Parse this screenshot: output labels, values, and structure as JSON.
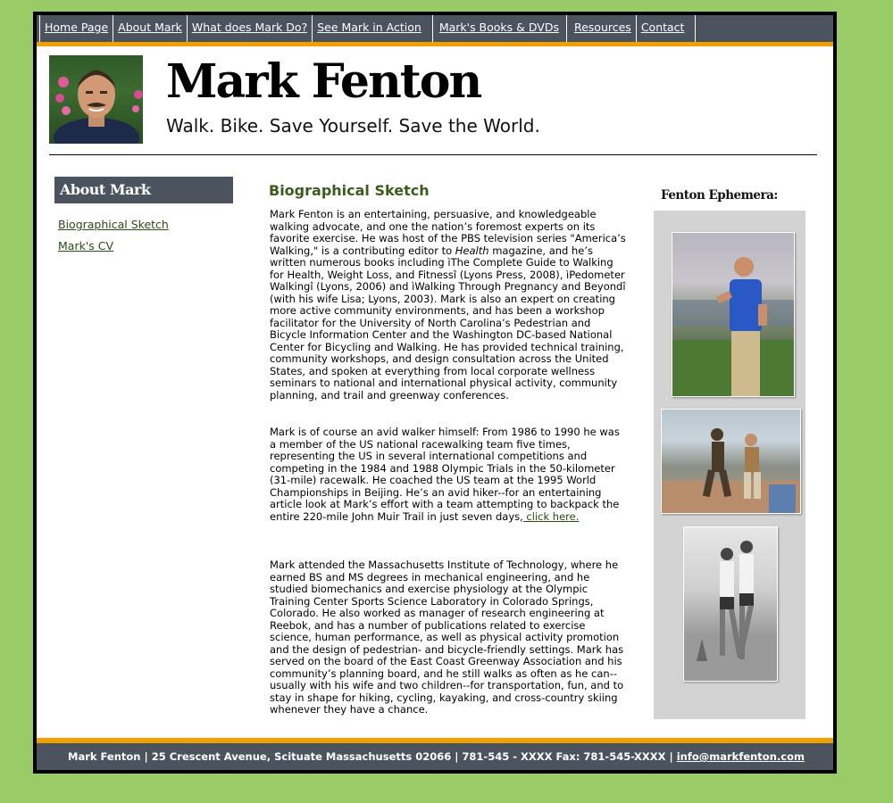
{
  "nav": {
    "items": [
      {
        "label": "Home Page"
      },
      {
        "label": "About Mark"
      },
      {
        "label": "What does Mark Do?"
      },
      {
        "label": "See Mark in Action"
      },
      {
        "label": "Mark's Books & DVDs"
      },
      {
        "label": "Resources"
      },
      {
        "label": "Contact"
      }
    ]
  },
  "header": {
    "title": "Mark Fenton",
    "tagline": "Walk. Bike. Save Yourself. Save the World."
  },
  "sidebar": {
    "heading": "About Mark",
    "links": [
      {
        "label": "Biographical Sketch"
      },
      {
        "label": "Mark's CV"
      }
    ]
  },
  "main": {
    "title": "Biographical Sketch",
    "para1_a": "Mark Fenton is an entertaining, persuasive, and knowledgeable walking advocate, and one the nation’s foremost experts on its favorite exercise. He was host of the PBS television series \"America’s Walking,\" is a contributing editor to ",
    "para1_em": "Health",
    "para1_b": " magazine, and he’s written numerous books including ìThe Complete Guide to Walking for Health, Weight Loss, and Fitnessî (Lyons Press, 2008), ìPedometer Walkingî (Lyons, 2006) and ìWalking Through Pregnancy and Beyondî (with his wife Lisa; Lyons, 2003). Mark is also an expert on creating more active community environments, and has been a workshop facilitator for the University of North Carolina’s Pedestrian and Bicycle Information Center and the Washington DC-based National Center for Bicycling and Walking. He has provided technical training, community workshops, and design consultation across the United States, and spoken at everything from local corporate wellness seminars to national and international physical activity, community planning, and trail and greenway conferences.",
    "para2": "Mark is of course an avid walker himself: From 1986 to 1990 he was a member of the US national racewalking team five times, representing the US in several international competitions and competing in the 1984 and 1988 Olympic Trials in the 50-kilometer (31-mile) racewalk. He coached the US team at the 1995 World Championships in Beijing. He’s an avid hiker--for an entertaining article look at Mark’s effort with a team attempting to backpack the entire 220-mile John Muir Trail in just seven days,",
    "para2_link": " click here.",
    "para3": " Mark attended the Massachusetts Institute of Technology, where he earned BS and MS degrees in mechanical engineering, and he studied biomechanics and exercise physiology at the Olympic Training Center Sports Science Laboratory in Colorado Springs, Colorado. He also worked as manager of research engineering at Reebok, and has a number of publications related to exercise science, human performance, as well as physical activity promotion and the design of pedestrian- and bicycle-friendly settings. Mark has served on the board of the East Coast Greenway Association and his community’s planning board, and he still walks as often as he can--usually with his wife and two children--for transportation, fun, and to stay in shape for hiking, cycling, kayaking, and cross-country skiing whenever they have a chance."
  },
  "ephemera": {
    "title": "Fenton Ephemera:"
  },
  "footer": {
    "text": "Mark Fenton | 25 Crescent Avenue, Scituate Massachusetts 02066 | 781-545 - XXXX  Fax: 781-545-XXXX  | ",
    "email": "info@markfenton.com"
  },
  "colors": {
    "background": "#99cc66",
    "nav_bar": "#4a535e",
    "accent_orange": "#f0a000",
    "link_green": "#2d4a14",
    "heading_green": "#3c5c1e"
  }
}
